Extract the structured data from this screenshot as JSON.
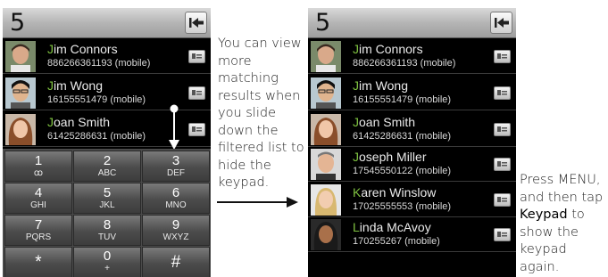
{
  "left_screen": {
    "dialed": "5",
    "contacts": [
      {
        "initial": "J",
        "rest": "im Connors",
        "number": "886266361193 (mobile)"
      },
      {
        "initial": "J",
        "rest": "im Wong",
        "number": "16155551479 (mobile)"
      },
      {
        "initial": "J",
        "rest": "oan Smith",
        "number": "61425286631 (mobile)"
      }
    ],
    "keypad": [
      {
        "digit": "1",
        "letters": "ꝏ"
      },
      {
        "digit": "2",
        "letters": "ABC"
      },
      {
        "digit": "3",
        "letters": "DEF"
      },
      {
        "digit": "4",
        "letters": "GHI"
      },
      {
        "digit": "5",
        "letters": "JKL"
      },
      {
        "digit": "6",
        "letters": "MNO"
      },
      {
        "digit": "7",
        "letters": "PQRS"
      },
      {
        "digit": "8",
        "letters": "TUV"
      },
      {
        "digit": "9",
        "letters": "WXYZ"
      },
      {
        "digit": "*",
        "letters": ""
      },
      {
        "digit": "0",
        "letters": "+"
      },
      {
        "digit": "#",
        "letters": ""
      }
    ]
  },
  "right_screen": {
    "dialed": "5",
    "contacts": [
      {
        "initial": "J",
        "rest": "im Connors",
        "number": "886266361193 (mobile)"
      },
      {
        "initial": "J",
        "rest": "im Wong",
        "number": "16155551479 (mobile)"
      },
      {
        "initial": "J",
        "rest": "oan Smith",
        "number": "61425286631 (mobile)"
      },
      {
        "initial": "J",
        "rest": "oseph Miller",
        "number": "17545550122 (mobile)"
      },
      {
        "initial": "K",
        "rest": "aren Winslow",
        "number": "17025555553 (mobile)"
      },
      {
        "initial": "L",
        "rest": "inda McAvoy",
        "number": "170255267 (mobile)"
      }
    ]
  },
  "captions": {
    "left": "You can view more matching results when you slide down the filtered list to hide the keypad.",
    "right_part1": "Press MENU, and then tap ",
    "right_keyword": "Keypad",
    "right_part2": " to show the keypad again."
  },
  "colors": {
    "highlight": "#7fc241",
    "background": "#000000"
  }
}
